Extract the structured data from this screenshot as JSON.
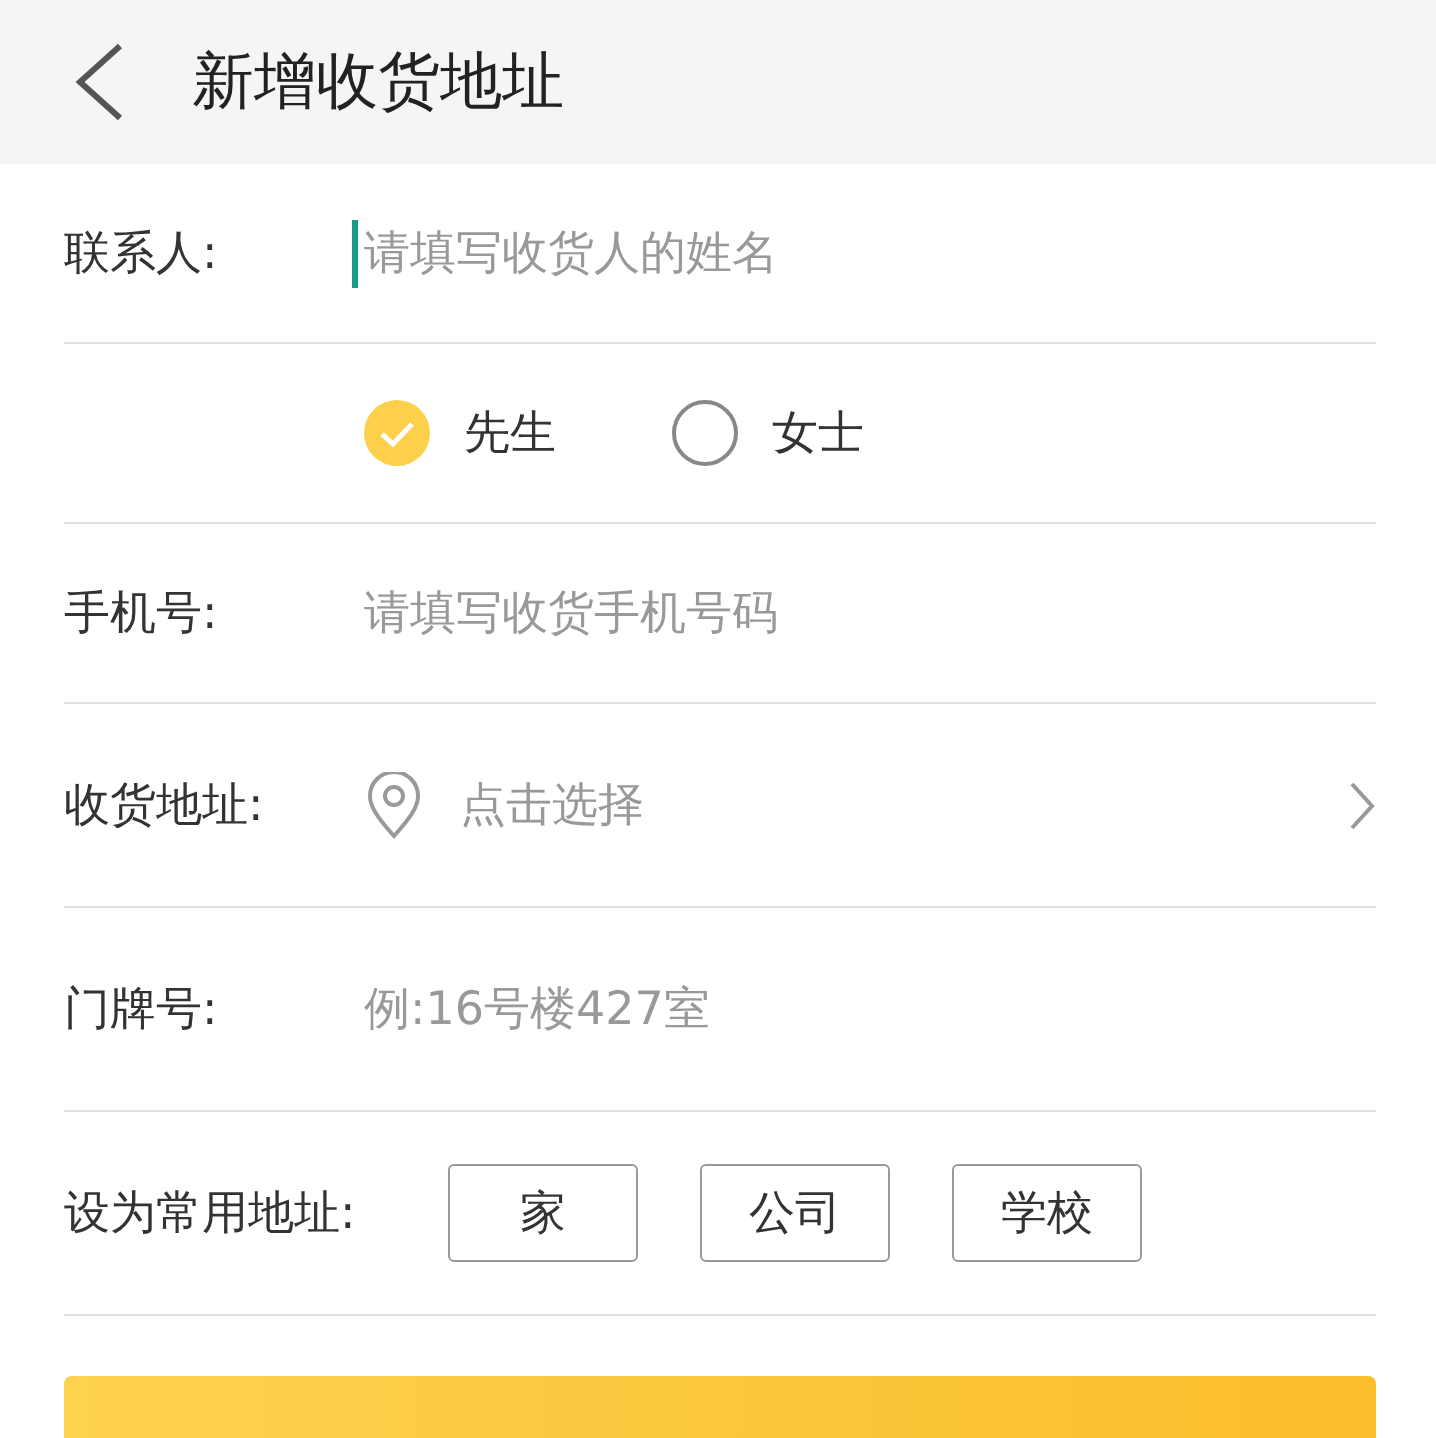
{
  "header": {
    "title": "新增收货地址"
  },
  "contact": {
    "label": "联系人:",
    "placeholder": "请填写收货人的姓名",
    "focused": true
  },
  "gender": [
    {
      "label": "先生",
      "selected": true
    },
    {
      "label": "女士",
      "selected": false
    }
  ],
  "phone": {
    "label": "手机号:",
    "placeholder": "请填写收货手机号码"
  },
  "address": {
    "label": "收货地址:",
    "placeholder": "点击选择"
  },
  "door": {
    "label": "门牌号:",
    "placeholder": "例:16号楼427室"
  },
  "tags": {
    "label": "设为常用地址:",
    "options": [
      {
        "label": "家",
        "selected": false
      },
      {
        "label": "公司",
        "selected": false
      },
      {
        "label": "学校",
        "selected": false
      }
    ]
  }
}
